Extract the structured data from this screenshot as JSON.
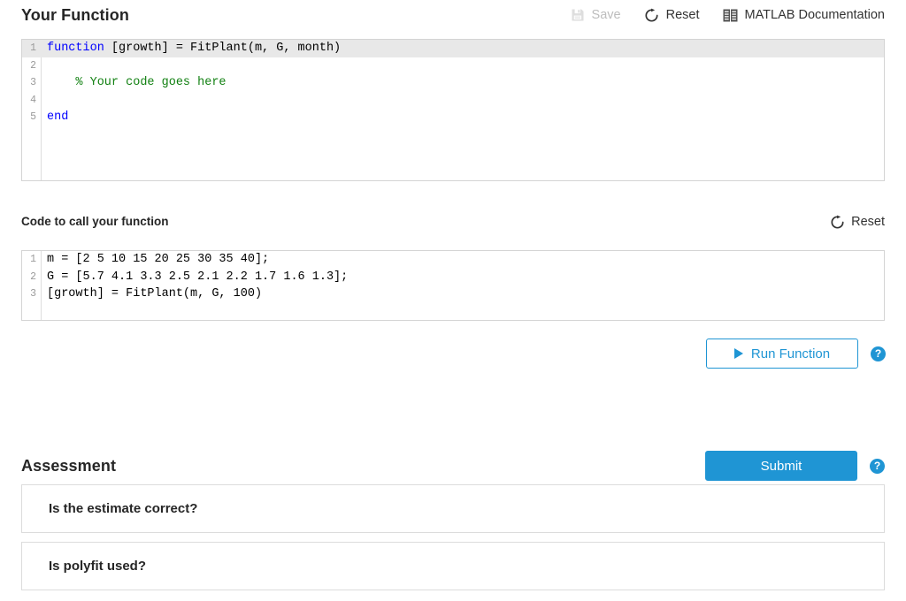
{
  "function_section": {
    "title": "Your Function",
    "toolbar": [
      {
        "label": "Save",
        "icon": "save-disk-icon",
        "disabled": true
      },
      {
        "label": "Reset",
        "icon": "reset-refresh-icon",
        "disabled": false
      },
      {
        "label": "MATLAB Documentation",
        "icon": "documentation-book-icon",
        "disabled": false
      }
    ],
    "editor": {
      "lines": [
        {
          "num": "1",
          "active": true,
          "segments": [
            {
              "t": "function",
              "c": "kw"
            },
            {
              "t": " [growth] = FitPlant(m, G, month)",
              "c": ""
            }
          ]
        },
        {
          "num": "2",
          "active": false,
          "segments": [
            {
              "t": "",
              "c": ""
            }
          ]
        },
        {
          "num": "3",
          "active": false,
          "segments": [
            {
              "t": "    % Your code goes here",
              "c": "cm"
            }
          ]
        },
        {
          "num": "4",
          "active": false,
          "segments": [
            {
              "t": "",
              "c": ""
            }
          ]
        },
        {
          "num": "5",
          "active": false,
          "segments": [
            {
              "t": "end",
              "c": "kw"
            }
          ]
        }
      ]
    }
  },
  "call_section": {
    "title": "Code to call your function",
    "reset_label": "Reset",
    "reset_icon": "reset-refresh-icon",
    "editor": {
      "lines": [
        {
          "num": "1",
          "active": false,
          "segments": [
            {
              "t": "m = [2 5 10 15 20 25 30 35 40];",
              "c": ""
            }
          ]
        },
        {
          "num": "2",
          "active": false,
          "segments": [
            {
              "t": "G = [5.7 4.1 3.3 2.5 2.1 2.2 1.7 1.6 1.3];",
              "c": ""
            }
          ]
        },
        {
          "num": "3",
          "active": false,
          "segments": [
            {
              "t": "[growth] = FitPlant(m, G, 100)",
              "c": ""
            }
          ]
        }
      ]
    },
    "run_button_label": "Run Function",
    "run_help_label": "?"
  },
  "assessment_section": {
    "title": "Assessment",
    "submit_label": "Submit",
    "submit_help_label": "?",
    "items": [
      {
        "label": "Is the estimate correct?"
      },
      {
        "label": "Is polyfit used?"
      }
    ]
  },
  "colors": {
    "accent_blue": "#1f95d4",
    "keyword_blue": "#0000ff",
    "comment_green": "#118011",
    "disabled_grey": "#bdbdbd",
    "border_grey": "#d4d4d4",
    "active_line_grey": "#e8e8e8"
  }
}
